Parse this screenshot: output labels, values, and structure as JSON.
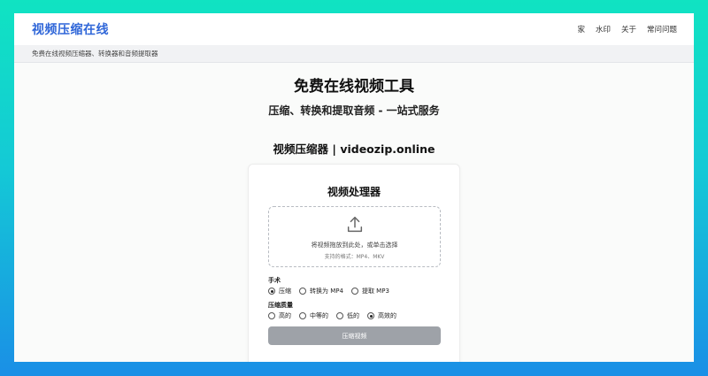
{
  "header": {
    "brand": "视频压缩在线",
    "nav": [
      "家",
      "水印",
      "关于",
      "常问问题"
    ]
  },
  "subbar": {
    "text": "免费在线视频压缩器、转换器和音频提取器"
  },
  "hero": {
    "title": "免费在线视频工具",
    "subtitle": "压缩、转换和提取音频 - 一站式服务",
    "tool_name": "视频压缩器 | videozip.online"
  },
  "processor": {
    "title": "视频处理器",
    "dropzone_main": "将视频拖放到此处，或单击选择",
    "dropzone_sub": "支持的格式：MP4、MKV",
    "operation_label": "手术",
    "operations": [
      {
        "label": "压缩",
        "selected": true
      },
      {
        "label": "转换为 MP4",
        "selected": false
      },
      {
        "label": "提取 MP3",
        "selected": false
      }
    ],
    "quality_label": "压缩质量",
    "qualities": [
      {
        "label": "高的",
        "selected": false
      },
      {
        "label": "中等的",
        "selected": false
      },
      {
        "label": "低的",
        "selected": false
      },
      {
        "label": "高效的",
        "selected": true
      }
    ],
    "button_label": "压缩视频"
  },
  "colors": {
    "brand": "#2f66d8",
    "button_disabled": "#9ea2a8"
  }
}
